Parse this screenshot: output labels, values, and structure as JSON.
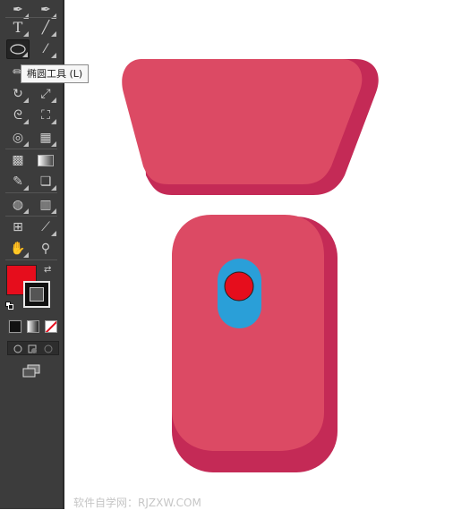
{
  "tooltip": {
    "text": "椭圆工具 (L)"
  },
  "toolbar": {
    "tools": [
      {
        "id": "pen-tool",
        "glyph": "✒",
        "selected": false
      },
      {
        "id": "curvature-tool",
        "glyph": "✒",
        "selected": false
      },
      {
        "id": "type-tool",
        "glyph": "T",
        "selected": false
      },
      {
        "id": "line-segment-tool",
        "glyph": "╱",
        "selected": false
      },
      {
        "id": "ellipse-tool",
        "glyph": "⬭",
        "selected": true
      },
      {
        "id": "paintbrush-tool",
        "glyph": "🖌",
        "selected": false
      },
      {
        "id": "pencil-tool",
        "glyph": "✏",
        "selected": false
      },
      {
        "id": "rotate-tool",
        "glyph": "↻",
        "selected": false
      },
      {
        "id": "scale-tool",
        "glyph": "⤢",
        "selected": false
      },
      {
        "id": "warp-tool",
        "glyph": "ᘓ",
        "selected": false
      },
      {
        "id": "free-transform-tool",
        "glyph": "⛶",
        "selected": false
      },
      {
        "id": "shape-builder-tool",
        "glyph": "◎",
        "selected": false
      },
      {
        "id": "perspective-grid-tool",
        "glyph": "▦",
        "selected": false
      },
      {
        "id": "mesh-tool",
        "glyph": "▩",
        "selected": false
      },
      {
        "id": "gradient-tool",
        "glyph": "▬",
        "selected": false
      },
      {
        "id": "eyedropper-tool",
        "glyph": "✎",
        "selected": false
      },
      {
        "id": "blend-tool",
        "glyph": "❏",
        "selected": false
      },
      {
        "id": "symbol-sprayer-tool",
        "glyph": "◍",
        "selected": false
      },
      {
        "id": "column-graph-tool",
        "glyph": "▥",
        "selected": false
      },
      {
        "id": "artboard-tool",
        "glyph": "⊞",
        "selected": false
      },
      {
        "id": "slice-tool",
        "glyph": "⟋",
        "selected": false
      },
      {
        "id": "hand-tool",
        "glyph": "✋",
        "selected": false
      },
      {
        "id": "zoom-tool",
        "glyph": "🔍",
        "selected": false
      }
    ],
    "fill_color": "#e60d1c",
    "stroke_color": "#111111"
  },
  "canvas": {
    "shape_fill": "#dc4a64",
    "shape_shadow": "#c42a56",
    "indicator_fill": "#2a9fd8",
    "button_fill": "#e60d1c"
  },
  "watermark": {
    "text": "软件自学网：RJZXW.COM"
  }
}
